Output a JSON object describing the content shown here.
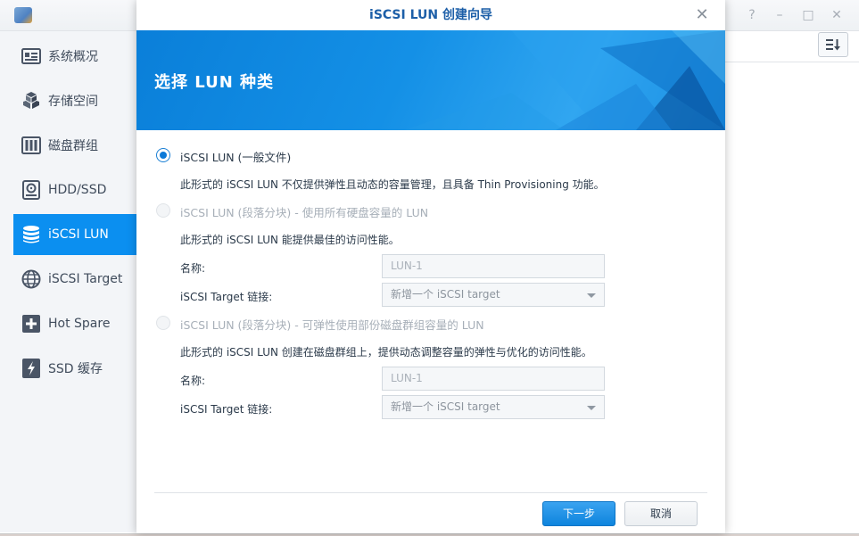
{
  "sidebar": {
    "items": [
      {
        "label": "系统概况",
        "icon": "overview-icon",
        "active": false
      },
      {
        "label": "存储空间",
        "icon": "storage-cubes-icon",
        "active": false
      },
      {
        "label": "磁盘群组",
        "icon": "disk-group-icon",
        "active": false
      },
      {
        "label": "HDD/SSD",
        "icon": "hdd-icon",
        "active": false
      },
      {
        "label": "iSCSI LUN",
        "icon": "lun-database-icon",
        "active": true
      },
      {
        "label": "iSCSI Target",
        "icon": "globe-icon",
        "active": false
      },
      {
        "label": "Hot Spare",
        "icon": "plus-box-icon",
        "active": false
      },
      {
        "label": "SSD 缓存",
        "icon": "lightning-ssd-icon",
        "active": false
      }
    ]
  },
  "window_controls": {
    "help": "?",
    "minimize": "–",
    "maximize": "□",
    "close": "✕"
  },
  "dialog": {
    "title": "iSCSI LUN 创建向导",
    "close": "✕",
    "banner_title": "选择 LUN 种类",
    "options": [
      {
        "label": "iSCSI LUN (一般文件)",
        "checked": true,
        "enabled": true,
        "description": "此形式的 iSCSI LUN 不仅提供弹性且动态的容量管理，且具备 Thin Provisioning 功能。"
      },
      {
        "label": "iSCSI LUN (段落分块) - 使用所有硬盘容量的 LUN",
        "checked": false,
        "enabled": false,
        "description": "此形式的 iSCSI LUN 能提供最佳的访问性能。",
        "name_label": "名称:",
        "name_value": "LUN-1",
        "target_label": "iSCSI Target 链接:",
        "target_value": "新增一个 iSCSI target"
      },
      {
        "label": "iSCSI LUN (段落分块) - 可弹性使用部份磁盘群组容量的 LUN",
        "checked": false,
        "enabled": false,
        "description": "此形式的 iSCSI LUN 创建在磁盘群组上，提供动态调整容量的弹性与优化的访问性能。",
        "name_label": "名称:",
        "name_value": "LUN-1",
        "target_label": "iSCSI Target 链接:",
        "target_value": "新增一个 iSCSI target"
      }
    ],
    "buttons": {
      "next": "下一步",
      "cancel": "取消"
    }
  },
  "colors": {
    "accent": "#0b8ff0",
    "title_blue": "#1d5fa8",
    "banner": "#1490e6"
  }
}
